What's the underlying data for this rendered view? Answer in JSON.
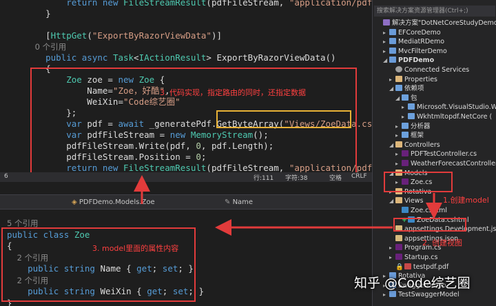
{
  "top_editor": {
    "lines": [
      {
        "parts": [
          [
            "kw",
            "        return "
          ],
          [
            "kw",
            "new "
          ],
          [
            "ty",
            "FileStreamResult"
          ],
          [
            "pl",
            "(pdfFileStream, "
          ],
          [
            "st",
            "\"application/pdf\""
          ],
          [
            "pl",
            ");"
          ]
        ]
      },
      {
        "parts": [
          [
            "pl",
            "    }"
          ]
        ]
      },
      {
        "parts": [
          [
            "pl",
            ""
          ]
        ]
      },
      {
        "parts": [
          [
            "pl",
            "    ["
          ],
          [
            "at",
            "HttpGet"
          ],
          [
            "pl",
            "("
          ],
          [
            "st",
            "\"ExportByRazorViewData\""
          ],
          [
            "pl",
            ")]"
          ]
        ]
      },
      {
        "parts": [
          [
            "cm",
            "    0 个引用"
          ]
        ]
      },
      {
        "parts": [
          [
            "kw",
            "    public async "
          ],
          [
            "ty",
            "Task"
          ],
          [
            "pl",
            "<"
          ],
          [
            "ty",
            "IActionResult"
          ],
          [
            "pl",
            "> ExportByRazorViewData()"
          ]
        ]
      },
      {
        "parts": [
          [
            "pl",
            "    {"
          ]
        ]
      },
      {
        "parts": [
          [
            "ty",
            "        Zoe "
          ],
          [
            "pl",
            "zoe = "
          ],
          [
            "kw",
            "new "
          ],
          [
            "ty",
            "Zoe "
          ],
          [
            "pl",
            "{"
          ]
        ]
      },
      {
        "parts": [
          [
            "pl",
            "            Name="
          ],
          [
            "st",
            "\"Zoe，好酷\""
          ],
          [
            "pl",
            ","
          ]
        ]
      },
      {
        "parts": [
          [
            "pl",
            "            WeiXin="
          ],
          [
            "st",
            "\"Code综艺圈\""
          ]
        ]
      },
      {
        "parts": [
          [
            "pl",
            "        };"
          ]
        ]
      },
      {
        "parts": [
          [
            "kw",
            "        var "
          ],
          [
            "pl",
            "pdf = "
          ],
          [
            "kw",
            "await "
          ],
          [
            "pl",
            "_generatePdf.GetByteArray("
          ],
          [
            "st",
            "\"Views/ZoeData.cshtml\""
          ],
          [
            "pl",
            ",zoe);"
          ]
        ]
      },
      {
        "parts": [
          [
            "kw",
            "        var "
          ],
          [
            "pl",
            "pdfFileStream = "
          ],
          [
            "kw",
            "new "
          ],
          [
            "ty",
            "MemoryStream"
          ],
          [
            "pl",
            "();"
          ]
        ]
      },
      {
        "parts": [
          [
            "pl",
            "        pdfFileStream.Write(pdf, "
          ],
          [
            "nm",
            "0"
          ],
          [
            "pl",
            ", pdf.Length);"
          ]
        ]
      },
      {
        "parts": [
          [
            "pl",
            "        pdfFileStream.Position = "
          ],
          [
            "nm",
            "0"
          ],
          [
            "pl",
            ";"
          ]
        ]
      },
      {
        "parts": [
          [
            "kw",
            "        return new "
          ],
          [
            "ty",
            "FileStreamResult"
          ],
          [
            "pl",
            "(pdfFileStream, "
          ],
          [
            "st",
            "\"application/pdf\""
          ],
          [
            "pl",
            ");"
          ]
        ]
      }
    ],
    "annotation": "3. 代码实现，指定路由的同时，还指定数据"
  },
  "top_status": {
    "line_no": "6",
    "pos": "行:111",
    "chars": "字符:38",
    "mode": "空格",
    "eol": "CRLF"
  },
  "nav_bar": {
    "class_path": "PDFDemo.Models.Zoe",
    "member": "Name"
  },
  "bottom_editor": {
    "lines": [
      {
        "parts": [
          [
            "cm",
            "5 个引用"
          ]
        ]
      },
      {
        "parts": [
          [
            "kw",
            "public class "
          ],
          [
            "ty",
            "Zoe"
          ]
        ]
      },
      {
        "parts": [
          [
            "pl",
            "{"
          ]
        ]
      },
      {
        "parts": [
          [
            "cm",
            "    2 个引用"
          ]
        ]
      },
      {
        "parts": [
          [
            "kw",
            "    public string "
          ],
          [
            "pl",
            "Name { "
          ],
          [
            "kw",
            "get"
          ],
          [
            "pl",
            "; "
          ],
          [
            "kw",
            "set"
          ],
          [
            "pl",
            "; }"
          ]
        ]
      },
      {
        "parts": [
          [
            "cm",
            "    2 个引用"
          ]
        ]
      },
      {
        "parts": [
          [
            "kw",
            "    public string "
          ],
          [
            "pl",
            "WeiXin { "
          ],
          [
            "kw",
            "get"
          ],
          [
            "pl",
            "; "
          ],
          [
            "kw",
            "set"
          ],
          [
            "pl",
            "; }"
          ]
        ]
      },
      {
        "parts": [
          [
            "pl",
            "}"
          ]
        ]
      }
    ],
    "annotation": "3. model里面的属性内容"
  },
  "solution_explorer": {
    "search_placeholder": "搜索解决方案资源管理器(Ctrl+;)",
    "items": [
      {
        "text": "解决方案\"DotNetCoreStudyDemo\"(12",
        "indent": 0,
        "arrow": "",
        "icon": "sol"
      },
      {
        "text": "EFCoreDemo",
        "indent": 1,
        "arrow": "▸",
        "icon": "proj"
      },
      {
        "text": "MediatRDemo",
        "indent": 1,
        "arrow": "▸",
        "icon": "proj"
      },
      {
        "text": "MvcFilterDemo",
        "indent": 1,
        "arrow": "▸",
        "icon": "proj"
      },
      {
        "text": "PDFDemo",
        "indent": 1,
        "arrow": "◢",
        "icon": "proj",
        "bold": true
      },
      {
        "text": "Connected Services",
        "indent": 2,
        "arrow": "",
        "icon": "gear"
      },
      {
        "text": "Properties",
        "indent": 2,
        "arrow": "▸",
        "icon": "folder"
      },
      {
        "text": "依赖项",
        "indent": 2,
        "arrow": "◢",
        "icon": "ref"
      },
      {
        "text": "包",
        "indent": 3,
        "arrow": "◢",
        "icon": "ref"
      },
      {
        "text": "Microsoft.VisualStudio.W",
        "indent": 4,
        "arrow": "▸",
        "icon": "ref"
      },
      {
        "text": "Wkhtmltopdf.NetCore (",
        "indent": 4,
        "arrow": "▸",
        "icon": "ref"
      },
      {
        "text": "分析器",
        "indent": 3,
        "arrow": "▸",
        "icon": "ref"
      },
      {
        "text": "框架",
        "indent": 3,
        "arrow": "▸",
        "icon": "ref"
      },
      {
        "text": "Controllers",
        "indent": 2,
        "arrow": "◢",
        "icon": "folder"
      },
      {
        "text": "PDFTestController.cs",
        "indent": 3,
        "arrow": "▸",
        "icon": "cs"
      },
      {
        "text": "WeatherForecastController",
        "indent": 3,
        "arrow": "▸",
        "icon": "cs"
      },
      {
        "text": "Models",
        "indent": 2,
        "arrow": "◢",
        "icon": "folder"
      },
      {
        "text": "Zoe.cs",
        "indent": 3,
        "arrow": "▸",
        "icon": "cs"
      },
      {
        "text": "Rotativa",
        "indent": 2,
        "arrow": "▸",
        "icon": "folder"
      },
      {
        "text": "Views",
        "indent": 2,
        "arrow": "◢",
        "icon": "folder"
      },
      {
        "text": "Zoe.cshtml",
        "indent": 3,
        "arrow": "",
        "icon": "cshtml"
      },
      {
        "text": "ZoeData.cshtml",
        "indent": 3,
        "arrow": "",
        "icon": "cshtml",
        "plus": true
      },
      {
        "text": "appsettings.Development.json",
        "indent": 2,
        "arrow": "",
        "icon": "json"
      },
      {
        "text": "appsettings.json",
        "indent": 2,
        "arrow": "",
        "icon": "json"
      },
      {
        "text": "Program.cs",
        "indent": 2,
        "arrow": "▸",
        "icon": "cs"
      },
      {
        "text": "Startup.cs",
        "indent": 2,
        "arrow": "▸",
        "icon": "cs"
      },
      {
        "text": "testpdf.pdf",
        "indent": 2,
        "arrow": "",
        "icon": "pdf",
        "lock": true
      },
      {
        "text": "Rotativa",
        "indent": 1,
        "arrow": "▸",
        "icon": "proj"
      },
      {
        "text": "SwaggerDemo",
        "indent": 1,
        "arrow": "▸",
        "icon": "proj"
      },
      {
        "text": "TestSwaggerModel",
        "indent": 1,
        "arrow": "▸",
        "icon": "proj"
      }
    ],
    "annotation_model": "1.创建model",
    "annotation_view": "2. 创建视图"
  },
  "watermark": "知乎 @Code综艺圈",
  "colors": {
    "annotation_red": "#e23b3b",
    "highlight_yellow": "#e8b236",
    "editor_bg": "#1e1e1e",
    "keyword_blue": "#569cd6",
    "type_teal": "#4ec9b0",
    "string_salmon": "#d69d85"
  }
}
